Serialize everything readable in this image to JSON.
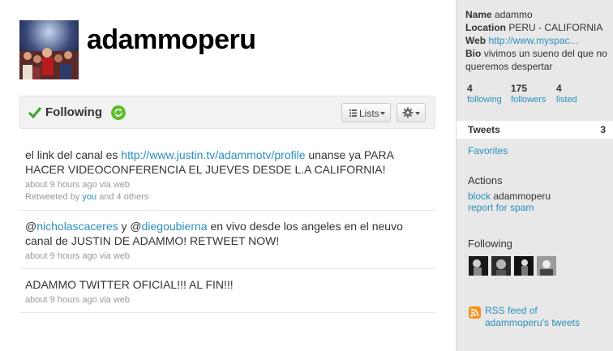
{
  "profile": {
    "screen_name": "adammoperu",
    "avatar_icon": "profile-photo-crowd"
  },
  "follow_bar": {
    "status_label": "Following",
    "lists_label": "Lists",
    "check_icon": "checkmark-icon",
    "retweet_icon": "retweet-toggle-icon",
    "gear_icon": "gear-icon",
    "status_color": "#5cbf2a"
  },
  "tweets": [
    {
      "pre": "el link del canal es ",
      "link": "http://www.justin.tv/adammotv/profile",
      "post": " unanse ya PARA HACER VIDEOCONFERENCIA EL JUEVES DESDE L.A CALIFORNIA!",
      "meta": "about 9 hours ago via web",
      "retweet_pre": "Retweeted by ",
      "retweet_you": "you",
      "retweet_post": " and 4 others"
    },
    {
      "at1": "@",
      "mention1": "nicholascaceres",
      "mid": " y ",
      "at2": "@",
      "mention2": "diegoubierna",
      "post": " en vivo desde los angeles en el neuvo canal de JUSTIN DE ADAMMO! RETWEET NOW!",
      "meta": "about 9 hours ago via web"
    },
    {
      "text": "ADAMMO TWITTER OFICIAL!!! AL FIN!!!",
      "meta": "about 9 hours ago via web"
    }
  ],
  "sidebar": {
    "name_key": "Name",
    "name_val": "adammo",
    "location_key": "Location",
    "location_val": "PERU - CALIFORNIA",
    "web_key": "Web",
    "web_val": "http://www.myspac...",
    "bio_key": "Bio",
    "bio_val": "vivimos un sueno del que no queremos despertar",
    "stats": [
      {
        "num": "4",
        "label": "following"
      },
      {
        "num": "175",
        "label": "followers"
      },
      {
        "num": "4",
        "label": "listed"
      }
    ],
    "tweets_label": "Tweets",
    "tweets_count": "3",
    "favorites_label": "Favorites",
    "actions_heading": "Actions",
    "block_link": "block",
    "block_target": "adammoperu",
    "report_link": "report for spam",
    "following_heading": "Following",
    "rss_label": "RSS feed of adammoperu's tweets",
    "link_color": "#2a8fbd",
    "sidebar_bg": "#e8e8e8"
  }
}
